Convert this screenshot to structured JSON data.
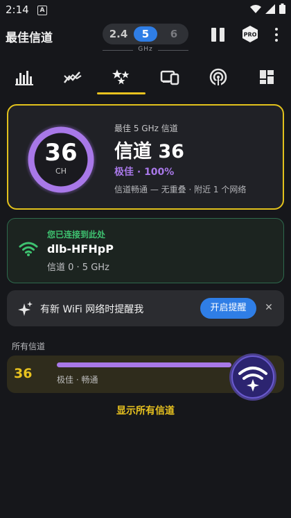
{
  "status_bar": {
    "time": "2:14",
    "badge": "A"
  },
  "app_bar": {
    "title": "最佳信道",
    "bands": [
      "2.4",
      "5",
      "6"
    ],
    "band_selected": "5",
    "band_unit": "GHz"
  },
  "tabs": [
    {
      "name": "bar-chart-icon"
    },
    {
      "name": "line-chart-icon"
    },
    {
      "name": "stars-icon",
      "selected": true
    },
    {
      "name": "devices-icon"
    },
    {
      "name": "broadcast-icon"
    },
    {
      "name": "grid-icon"
    }
  ],
  "best": {
    "channel": "36",
    "unit": "CH",
    "subtitle": "最佳 5 GHz 信道",
    "title": "信道 36",
    "quality": "极佳 · 100%",
    "description": "信道畅通 — 无重叠 · 附近 1 个网络"
  },
  "connected": {
    "label": "您已连接到此处",
    "ssid": "dlb-HFHpP",
    "details": "信道 0 · 5 GHz"
  },
  "notify": {
    "text": "有新 WiFi 网络时提醒我",
    "button": "开启提醒"
  },
  "all_channels": {
    "label": "所有信道",
    "rows": [
      {
        "channel": "36",
        "quality": "极佳 · 畅通"
      }
    ],
    "show_all": "显示所有信道"
  },
  "colors": {
    "accent_yellow": "#e2c21c",
    "purple": "#a878e8",
    "blue": "#2f7ee6",
    "green": "#3ec270"
  }
}
